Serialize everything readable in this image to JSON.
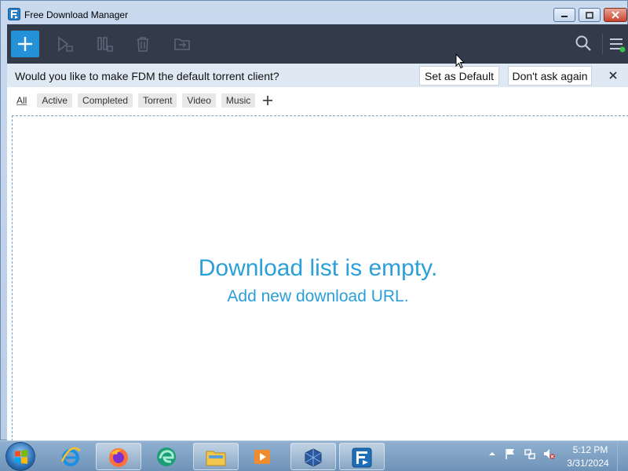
{
  "window": {
    "title": "Free Download Manager"
  },
  "toolbar": {
    "add_icon": "plus-icon",
    "icons": [
      "resume-icon",
      "pause-icon",
      "delete-icon",
      "move-icon",
      "search-icon",
      "menu-icon"
    ]
  },
  "notification": {
    "message": "Would you like to make FDM the default torrent client?",
    "set_default_label": "Set as Default",
    "dont_ask_label": "Don't ask again"
  },
  "tabs": [
    "All",
    "Active",
    "Completed",
    "Torrent",
    "Video",
    "Music"
  ],
  "empty_state": {
    "title": "Download list is empty.",
    "link": "Add new download URL."
  },
  "taskbar": {
    "apps": [
      "internet-explorer",
      "firefox",
      "edge",
      "file-explorer",
      "media-player",
      "virtualbox",
      "free-download-manager"
    ],
    "time": "5:12 PM",
    "date": "3/31/2024"
  },
  "colors": {
    "toolbar_bg": "#333b4b",
    "accent": "#2490d8",
    "empty_text": "#2b9fd9",
    "notification_bg": "#dfe9f3"
  }
}
